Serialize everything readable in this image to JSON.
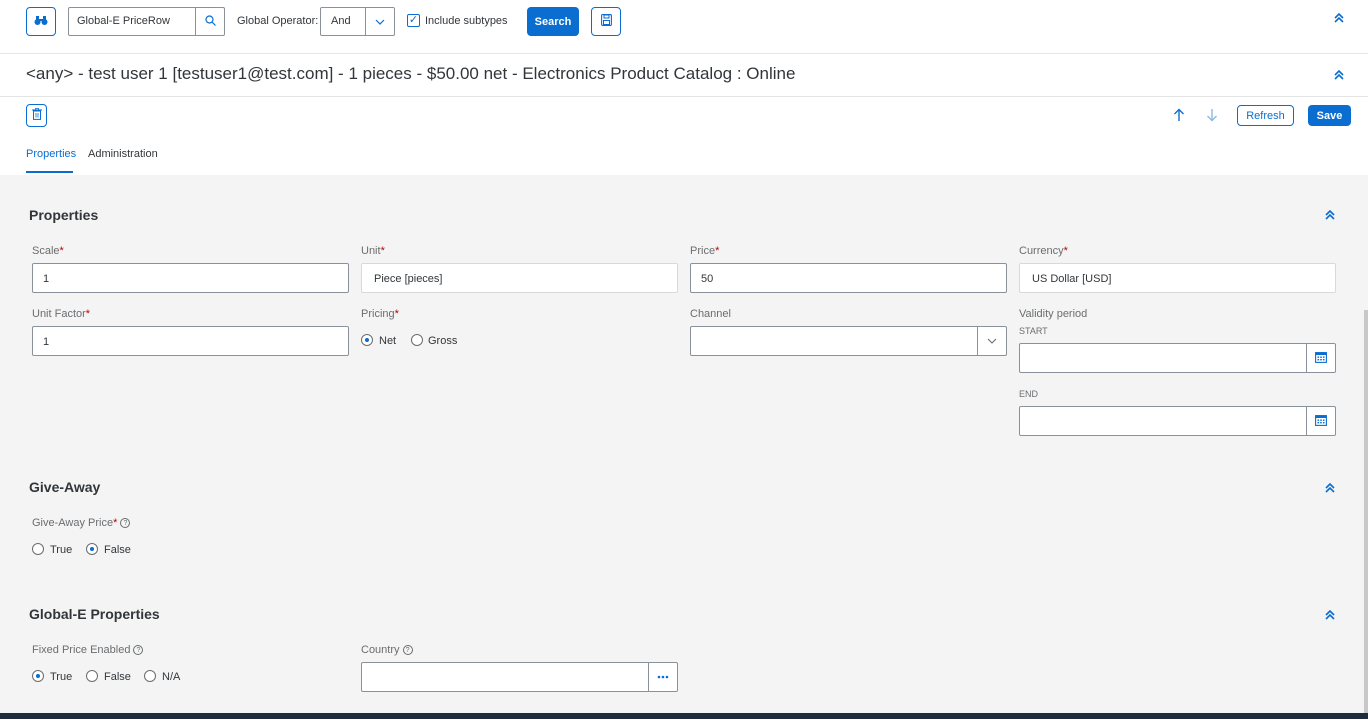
{
  "search": {
    "type_value": "Global-E PriceRow",
    "operator_label": "Global Operator:",
    "operator_value": "And",
    "include_subtypes_label": "Include subtypes",
    "search_button": "Search"
  },
  "header": {
    "title": "<any> - test user 1 [testuser1@test.com] - 1 pieces - $50.00 net - Electronics Product Catalog : Online",
    "refresh_button": "Refresh",
    "save_button": "Save"
  },
  "tabs": [
    {
      "label": "Properties",
      "active": true
    },
    {
      "label": "Administration",
      "active": false
    }
  ],
  "sections": {
    "properties": {
      "title": "Properties",
      "scale_label": "Scale",
      "scale_value": "1",
      "unit_label": "Unit",
      "unit_value": "Piece [pieces]",
      "price_label": "Price",
      "price_value": "50",
      "currency_label": "Currency",
      "currency_value": "US Dollar [USD]",
      "unit_factor_label": "Unit Factor",
      "unit_factor_value": "1",
      "pricing_label": "Pricing",
      "pricing_options": [
        "Net",
        "Gross"
      ],
      "pricing_selected": "Net",
      "channel_label": "Channel",
      "channel_value": "",
      "validity_label": "Validity period",
      "start_label": "START",
      "end_label": "END",
      "start_value": "",
      "end_value": ""
    },
    "give_away": {
      "title": "Give-Away",
      "price_label": "Give-Away Price",
      "options": [
        "True",
        "False"
      ],
      "selected": "False"
    },
    "global_e": {
      "title": "Global-E Properties",
      "fixed_price_label": "Fixed Price Enabled",
      "fixed_options": [
        "True",
        "False",
        "N/A"
      ],
      "fixed_selected": "True",
      "country_label": "Country",
      "country_value": ""
    }
  },
  "icons": {
    "binoculars": "binoculars-icon",
    "search": "search-icon",
    "save_query": "save-icon",
    "collapse": "chevron-double-up-icon",
    "delete": "trash-icon",
    "calendar": "calendar-icon",
    "help": "help-icon",
    "more": "ellipsis-icon"
  },
  "colors": {
    "accent": "#0a6ed1",
    "required": "#bb0000",
    "content_bg": "#f4f4f4"
  }
}
